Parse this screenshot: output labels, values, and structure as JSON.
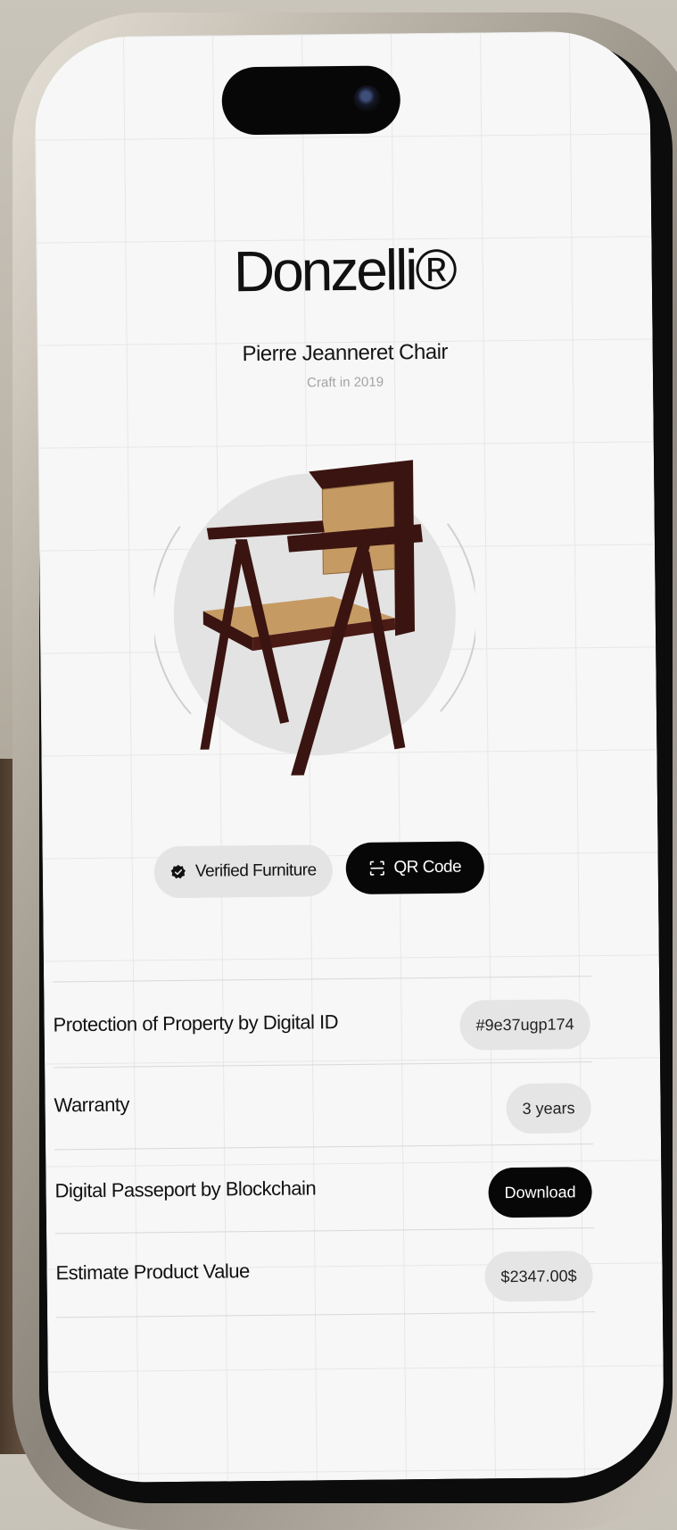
{
  "brand": {
    "name": "Donzelli®"
  },
  "product": {
    "name": "Pierre Jeanneret Chair",
    "subtitle": "Craft in 2019"
  },
  "actions": {
    "verified_label": "Verified Furniture",
    "qr_label": "QR Code"
  },
  "details": [
    {
      "label": "Protection of Property by Digital ID",
      "value": "#9e37ugp174",
      "style": "light"
    },
    {
      "label": "Warranty",
      "value": "3 years",
      "style": "light"
    },
    {
      "label": "Digital Passeport by Blockchain",
      "value": "Download",
      "style": "dark"
    },
    {
      "label": "Estimate Product Value",
      "value": "$2347.00$",
      "style": "light"
    }
  ],
  "colors": {
    "screen_bg": "#f7f7f7",
    "pill_light": "#e4e4e4",
    "pill_dark": "#070707",
    "chair_wood": "#3a1410",
    "cane": "#c69a63"
  },
  "icons": {
    "verified": "verified-badge-icon",
    "qr": "qr-scan-icon"
  }
}
